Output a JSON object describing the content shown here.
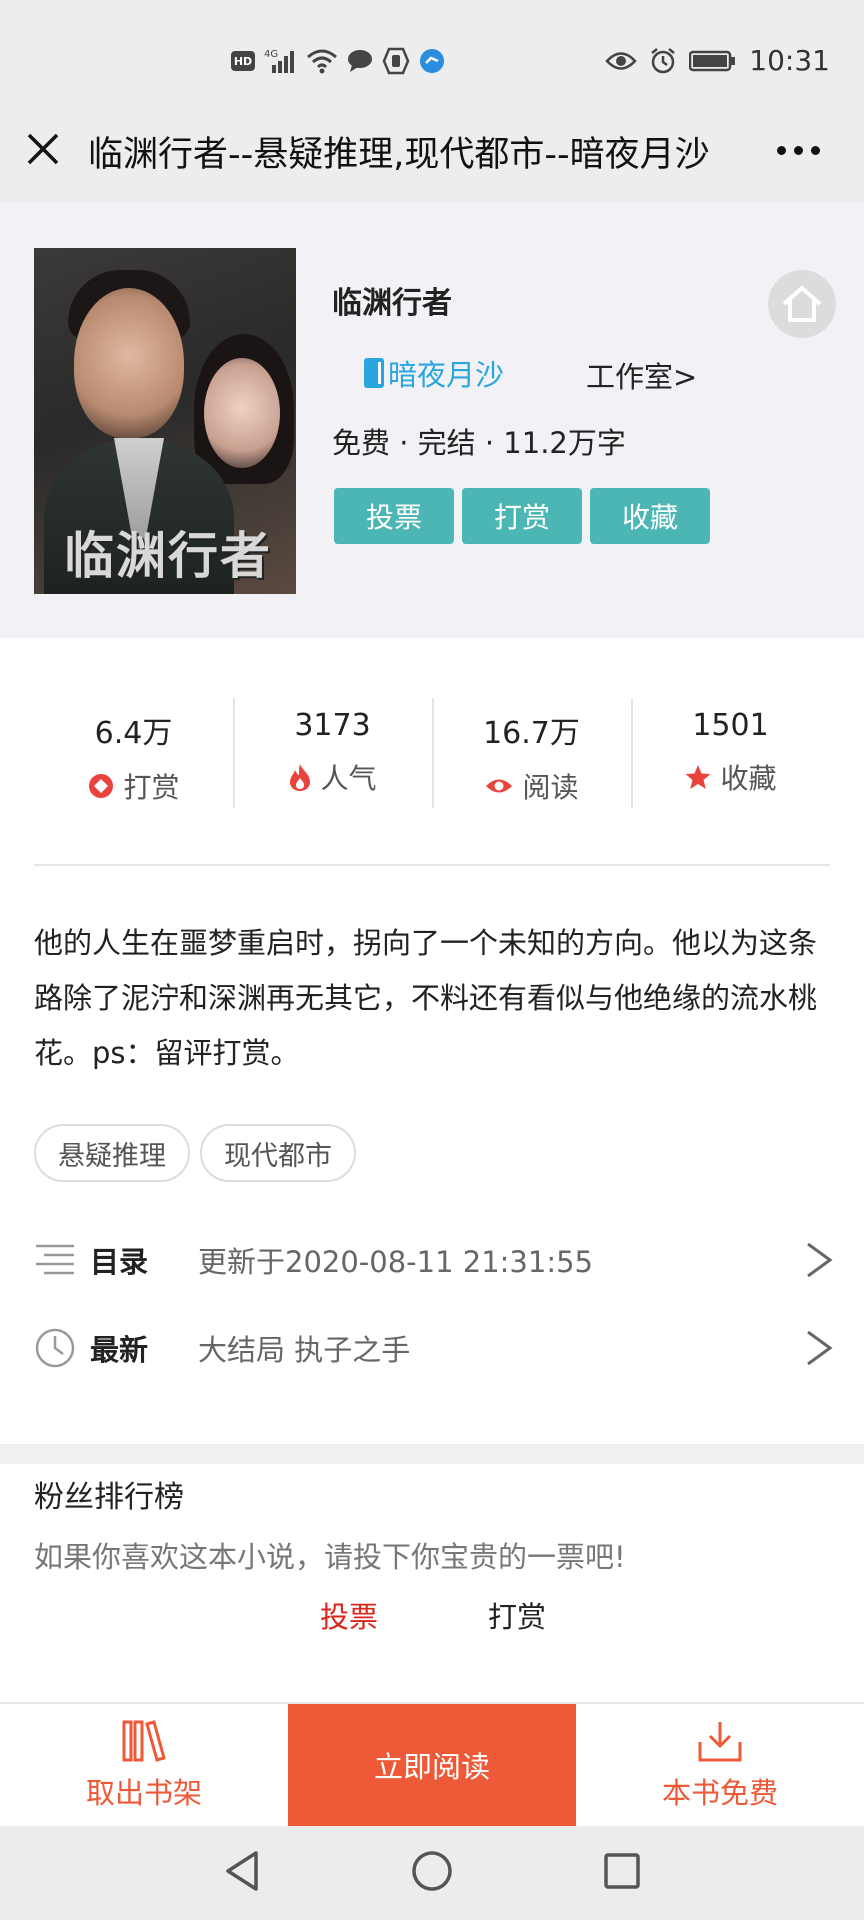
{
  "status_bar": {
    "time": "10:31",
    "left_icons": [
      "hd-icon",
      "signal-4g-icon",
      "wifi-icon",
      "chat-bubble-icon",
      "hand-icon",
      "app-icon"
    ],
    "right_icons": [
      "eye-icon",
      "alarm-icon",
      "battery-icon"
    ]
  },
  "titlebar": {
    "title": "临渊行者--悬疑推理,现代都市--暗夜月沙"
  },
  "book": {
    "cover_text": "临渊行者",
    "name": "临渊行者",
    "author": "暗夜月沙",
    "studio": "工作室>",
    "meta": "免费 · 完结 · 11.2万字",
    "buttons": [
      "投票",
      "打赏",
      "收藏"
    ]
  },
  "stats": [
    {
      "value": "6.4万",
      "label": "打赏",
      "icon": "reward-icon",
      "color": "#e8433c"
    },
    {
      "value": "3173",
      "label": "人气",
      "icon": "fire-icon",
      "color": "#e8433c"
    },
    {
      "value": "16.7万",
      "label": "阅读",
      "icon": "eye-icon",
      "color": "#e8433c"
    },
    {
      "value": "1501",
      "label": "收藏",
      "icon": "star-icon",
      "color": "#e8433c"
    }
  ],
  "description": "他的人生在噩梦重启时，拐向了一个未知的方向。他以为这条路除了泥泞和深渊再无其它，不料还有看似与他绝缘的流水桃花。ps：留评打赏。",
  "genres": [
    "悬疑推理",
    "现代都市"
  ],
  "catalog": {
    "label": "目录",
    "text": "更新于2020-08-11 21:31:55"
  },
  "latest": {
    "label": "最新",
    "text": "大结局 执子之手"
  },
  "fans": {
    "title": "粉丝排行榜",
    "subtitle": "如果你喜欢这本小说，请投下你宝贵的一票吧!",
    "vote": "投票",
    "tip": "打赏"
  },
  "actions": {
    "remove_shelf": "取出书架",
    "read_now": "立即阅读",
    "free_download": "本书免费"
  },
  "colors": {
    "accent": "#ee5a38",
    "teal": "#4bb6b3",
    "author_blue": "#29a6e0"
  }
}
